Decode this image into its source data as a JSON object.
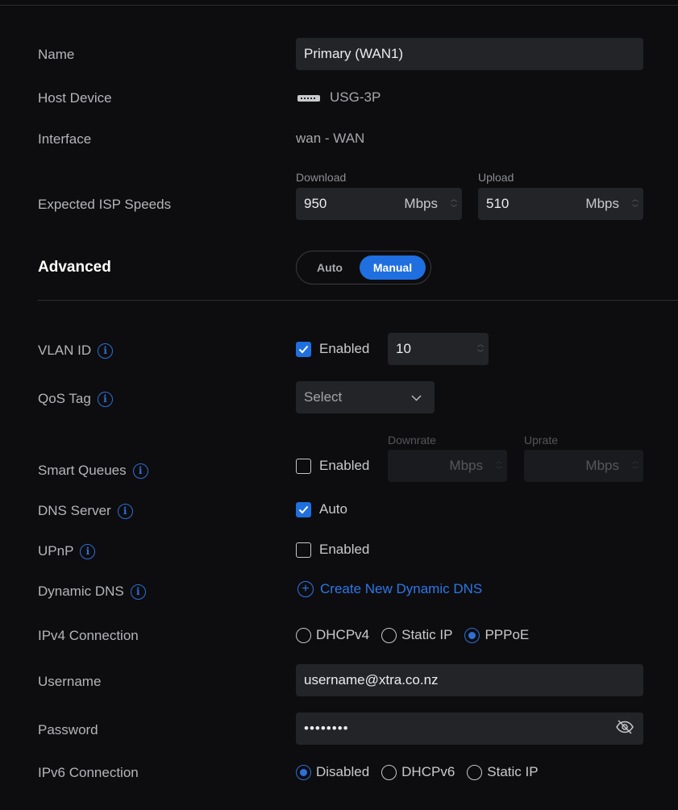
{
  "form": {
    "name": {
      "label": "Name",
      "value": "Primary (WAN1)"
    },
    "host_device": {
      "label": "Host Device",
      "value": "USG-3P",
      "icon": "router-device-icon"
    },
    "interface": {
      "label": "Interface",
      "value": "wan - WAN"
    },
    "isp_speeds": {
      "label": "Expected ISP Speeds",
      "download": {
        "caption": "Download",
        "value": "950",
        "unit": "Mbps"
      },
      "upload": {
        "caption": "Upload",
        "value": "510",
        "unit": "Mbps"
      }
    }
  },
  "advanced": {
    "label": "Advanced",
    "options": [
      "Auto",
      "Manual"
    ],
    "selected": "Manual",
    "accent_color": "#1f6fe0"
  },
  "vlan": {
    "label": "VLAN ID",
    "enabled_label": "Enabled",
    "enabled": true,
    "value": "10"
  },
  "qos": {
    "label": "QoS Tag",
    "placeholder": "Select"
  },
  "smart_queues": {
    "label": "Smart Queues",
    "enabled_label": "Enabled",
    "enabled": false,
    "downrate": {
      "caption": "Downrate",
      "unit": "Mbps"
    },
    "uprate": {
      "caption": "Uprate",
      "unit": "Mbps"
    }
  },
  "dns": {
    "label": "DNS Server",
    "option_label": "Auto",
    "checked": true
  },
  "upnp": {
    "label": "UPnP",
    "enabled_label": "Enabled",
    "enabled": false
  },
  "dynamic_dns": {
    "label": "Dynamic DNS",
    "link_text": "Create New Dynamic DNS"
  },
  "ipv4": {
    "label": "IPv4 Connection",
    "options": [
      "DHCPv4",
      "Static IP",
      "PPPoE"
    ],
    "selected": "PPPoE"
  },
  "username": {
    "label": "Username",
    "value": "username@xtra.co.nz"
  },
  "password": {
    "label": "Password",
    "value": "••••••••"
  },
  "ipv6": {
    "label": "IPv6 Connection",
    "options": [
      "Disabled",
      "DHCPv6",
      "Static IP"
    ],
    "selected": "Disabled"
  }
}
